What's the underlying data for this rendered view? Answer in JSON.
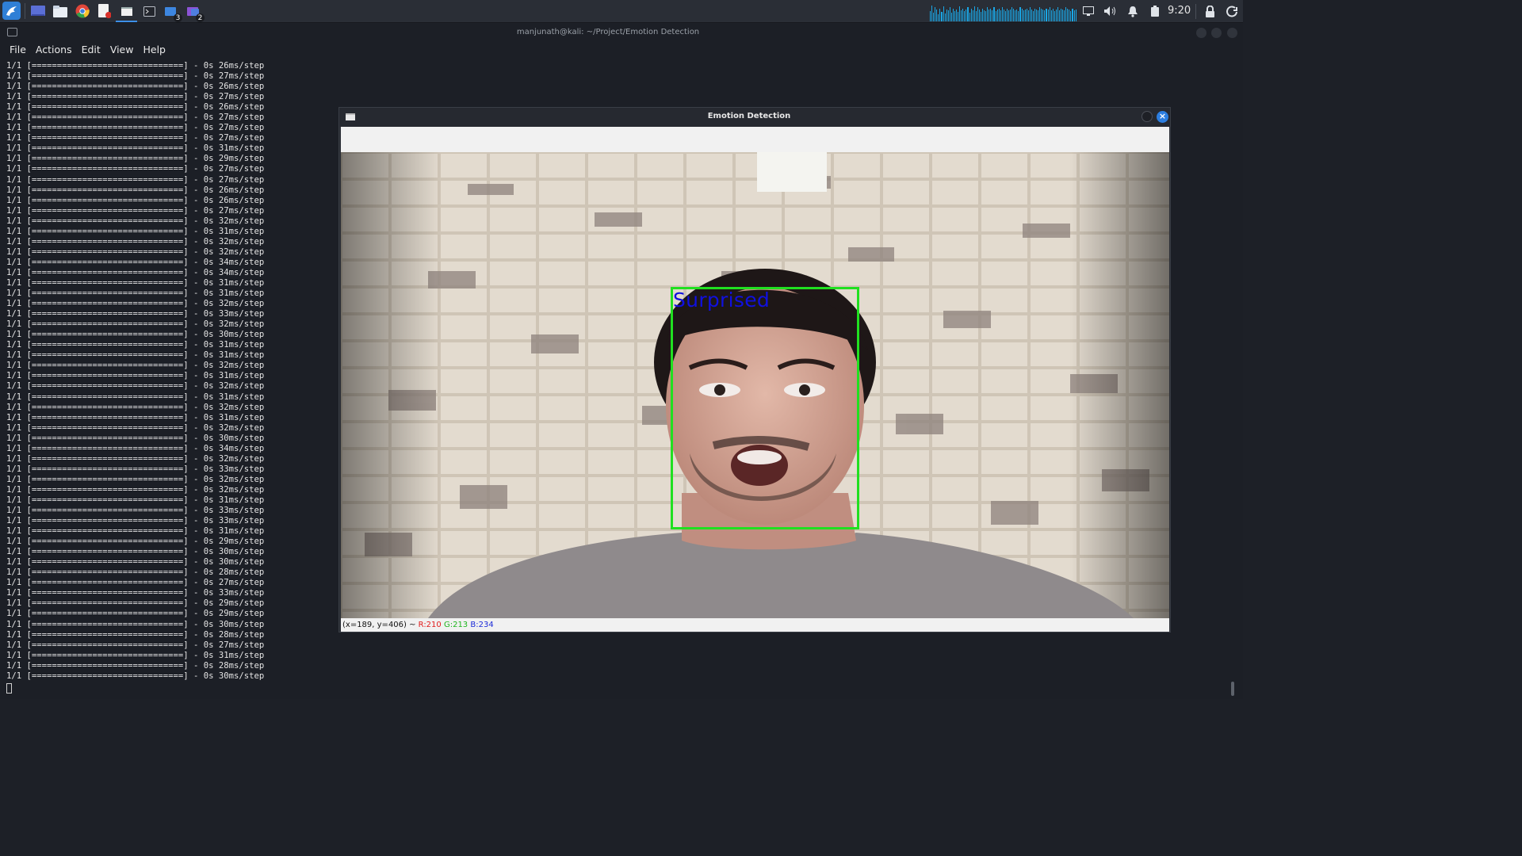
{
  "panel": {
    "clock": "9:20",
    "workspace_badges": [
      "3",
      "2"
    ],
    "cpu_graph": [
      12,
      18,
      10,
      16,
      14,
      8,
      15,
      11,
      17,
      9,
      14,
      13,
      16,
      10,
      15,
      12,
      14,
      11,
      17,
      13,
      15,
      12,
      14,
      16,
      10,
      15,
      13,
      17,
      12,
      16,
      14,
      11,
      15,
      13,
      12,
      16,
      14,
      15,
      13,
      16,
      12,
      14,
      15,
      13,
      16,
      14,
      12,
      15,
      13,
      14,
      16,
      15,
      13,
      14,
      12,
      16,
      15,
      13,
      14,
      15,
      13,
      16,
      14,
      12,
      15,
      14,
      13,
      16,
      15,
      14,
      13,
      15,
      14,
      16,
      13,
      15,
      12,
      14,
      16,
      13,
      15,
      14,
      13,
      16,
      15,
      14,
      12,
      15,
      13,
      14
    ]
  },
  "terminal": {
    "title": "manjunath@kali: ~/Project/Emotion Detection",
    "menu": [
      "File",
      "Actions",
      "Edit",
      "View",
      "Help"
    ],
    "log_prefix": "1/1 [",
    "log_bar": "==============================",
    "log_suffix": "] - 0s ",
    "step_times": [
      "26ms/step",
      "27ms/step",
      "26ms/step",
      "27ms/step",
      "26ms/step",
      "27ms/step",
      "27ms/step",
      "27ms/step",
      "31ms/step",
      "29ms/step",
      "27ms/step",
      "27ms/step",
      "26ms/step",
      "26ms/step",
      "27ms/step",
      "32ms/step",
      "31ms/step",
      "32ms/step",
      "32ms/step",
      "34ms/step",
      "34ms/step",
      "31ms/step",
      "31ms/step",
      "32ms/step",
      "33ms/step",
      "32ms/step",
      "30ms/step",
      "31ms/step",
      "31ms/step",
      "32ms/step",
      "31ms/step",
      "32ms/step",
      "31ms/step",
      "32ms/step",
      "31ms/step",
      "32ms/step",
      "30ms/step",
      "34ms/step",
      "32ms/step",
      "33ms/step",
      "32ms/step",
      "32ms/step",
      "31ms/step",
      "33ms/step",
      "33ms/step",
      "31ms/step",
      "29ms/step",
      "30ms/step",
      "30ms/step",
      "28ms/step",
      "27ms/step",
      "33ms/step",
      "29ms/step",
      "29ms/step",
      "30ms/step",
      "28ms/step",
      "27ms/step",
      "31ms/step",
      "28ms/step",
      "30ms/step"
    ]
  },
  "emotion_window": {
    "title": "Emotion Detection",
    "label": "Surprised",
    "status": {
      "coords": "(x=189, y=406) ~ ",
      "r": "R:210",
      "g": "G:213",
      "b": "B:234"
    }
  }
}
